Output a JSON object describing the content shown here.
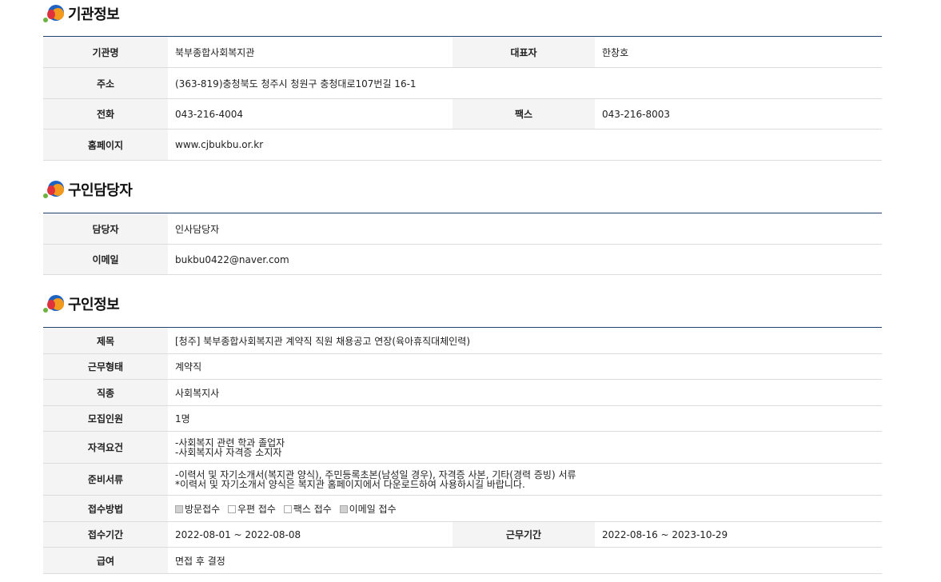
{
  "org": {
    "title": "기관정보",
    "name_label": "기관명",
    "name": "북부종합사회복지관",
    "rep_label": "대표자",
    "rep": "한창호",
    "addr_label": "주소",
    "addr": "(363-819)충청북도 청주시 청원구 충청대로107번길 16-1",
    "phone_label": "전화",
    "phone": "043-216-4004",
    "fax_label": "팩스",
    "fax": "043-216-8003",
    "home_label": "홈페이지",
    "home": "www.cjbukbu.or.kr"
  },
  "contact": {
    "title": "구인담당자",
    "person_label": "담당자",
    "person": "인사담당자",
    "email_label": "이메일",
    "email": "bukbu0422@naver.com"
  },
  "job": {
    "title": "구인정보",
    "subject_label": "제목",
    "subject": "[청주] 북부종합사회복지관 계약직 직원 채용공고 연장(육아휴직대체인력)",
    "type_label": "근무형태",
    "type": "계약직",
    "field_label": "직종",
    "field": "사회복지사",
    "count_label": "모집인원",
    "count": "1명",
    "qual_label": "자격요건",
    "qual_1": "-사회복지 관련 학과 졸업자",
    "qual_2": "-사회복지사 자격증 소지자",
    "docs_label": "준비서류",
    "docs_1": "-이력서 및 자기소개서(복지관 양식), 주민등록초본(남성일 경우), 자격증 사본, 기타(경력 증빙) 서류",
    "docs_2": "*이력서 및 자기소개서 양식은 복지관 홈페이지에서 다운로드하여 사용하시길 바랍니다.",
    "method_label": "접수방법",
    "methods": [
      {
        "label": "방문접수",
        "checked": true
      },
      {
        "label": "우편 접수",
        "checked": false
      },
      {
        "label": "팩스 접수",
        "checked": false
      },
      {
        "label": "이메일 접수",
        "checked": true
      }
    ],
    "period_label": "접수기간",
    "period": "2022-08-01 ~ 2022-08-08",
    "work_period_label": "근무기간",
    "work_period": "2022-08-16 ~ 2023-10-29",
    "salary_label": "급여",
    "salary": "면접 후 결정"
  }
}
